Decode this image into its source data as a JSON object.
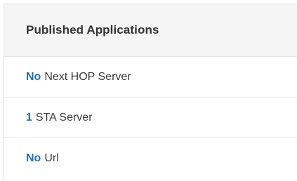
{
  "panel": {
    "title": "Published Applications",
    "rows": [
      {
        "value": "No",
        "label": "Next HOP Server"
      },
      {
        "value": "1",
        "label": "STA Server"
      },
      {
        "value": "No",
        "label": "Url"
      }
    ]
  },
  "colors": {
    "accent": "#1f6fb2",
    "header_bg": "#f5f5f5",
    "border": "#e6e6e6"
  }
}
